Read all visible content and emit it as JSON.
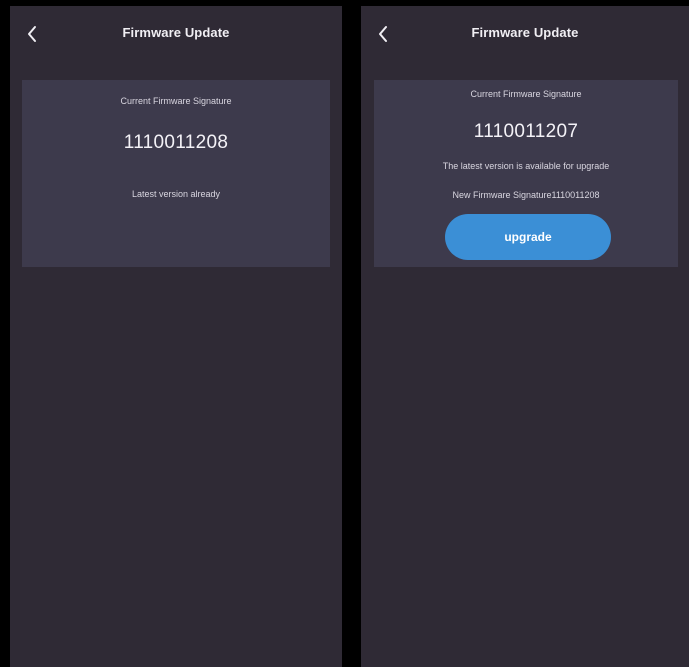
{
  "left_screen": {
    "title": "Firmware Update",
    "card": {
      "current_label": "Current Firmware Signature",
      "current_value": "1110011208",
      "status": "Latest version already"
    }
  },
  "right_screen": {
    "title": "Firmware Update",
    "card": {
      "current_label": "Current Firmware Signature",
      "current_value": "1110011207",
      "status": "The latest version is available for upgrade",
      "new_signature": "New Firmware Signature1110011208",
      "upgrade_label": "upgrade"
    }
  },
  "colors": {
    "background": "#000000",
    "screen": "#2f2a35",
    "card": "#3d3a4c",
    "accent": "#3b8fd6"
  },
  "icons": {
    "back": "chevron-left-icon"
  }
}
